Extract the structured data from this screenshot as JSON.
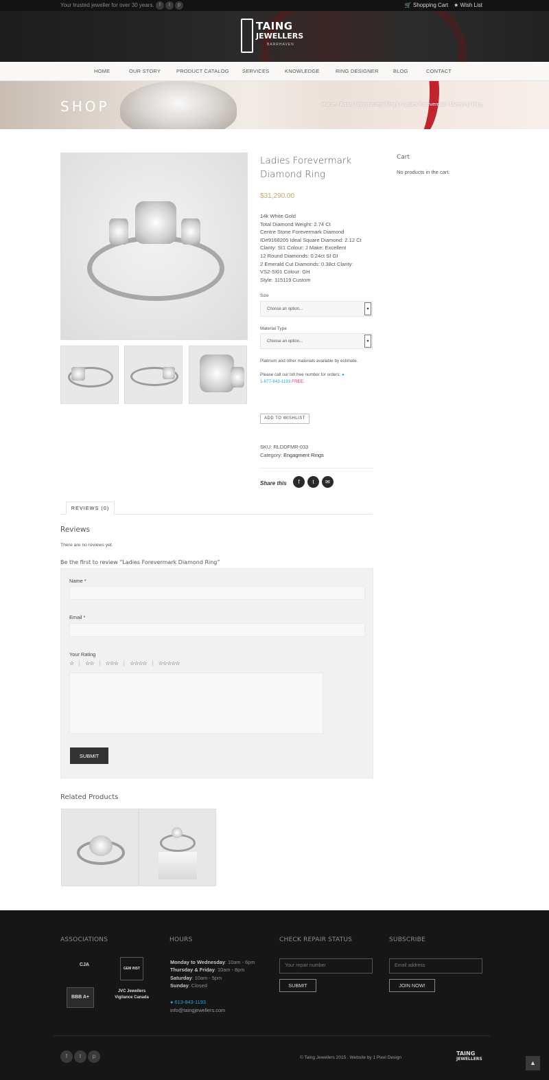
{
  "topbar": {
    "tagline": "Your trusted jeweller for over 30 years.",
    "social_icons": [
      "f",
      "t",
      "p"
    ],
    "cart": "Shopping Cart",
    "wishlist": "Wish List"
  },
  "logo": {
    "line1": "TAING",
    "line2": "JEWELLERS",
    "line3": "BARRHAVEN"
  },
  "nav": [
    "HOME",
    "OUR STORY",
    "PRODUCT CATALOG",
    "SERVICES",
    "KNOWLEDGE",
    "RING DESIGNER",
    "BLOG",
    "CONTACT"
  ],
  "banner": {
    "title": "SHOP",
    "breadcrumb": "Home / Bridal / Engagment Rings / Ladies Forevermark Diamond Ring"
  },
  "product": {
    "title": "Ladies Forevermark Diamond Ring",
    "price": "$31,290.00",
    "description": [
      "14k White Gold",
      "Total Diamond Weight: 2.74 Ct",
      "Centre Stone Forevermark Diamond",
      "ID#9168205 Ideal Square Diamond: 2.12 Ct",
      "Clarity: SI1 Colour: J Make: Excellent",
      "12 Round Diamonds: 0.24ct SI GI",
      "2 Emerald Cut Diamonds: 0.38ct Clarity:",
      "VS2-SI01 Colour: GH",
      "Style: 115119 Custom"
    ],
    "size_label": "Size",
    "size_placeholder": "Choose an option...",
    "material_label": "Material Type",
    "material_placeholder": "Choose an option...",
    "estimate_note": "Platinum and other materials available by estimate.",
    "call_note": "Please call our toll free number for orders:",
    "phone": "1-877-843-1193",
    "free": "FREE.",
    "wishlist_button": "ADD TO WISHLIST",
    "sku_label": "SKU:",
    "sku": "RLDDFMR-033",
    "category_label": "Category:",
    "category": "Engagment Rings",
    "share_label": "Share this"
  },
  "sidebar": {
    "cart_title": "Cart",
    "cart_empty": "No products in the cart."
  },
  "reviews": {
    "tab": "REVIEWS (0)",
    "heading": "Reviews",
    "none": "There are no reviews yet.",
    "first": "Be the first to review “Ladies Forevermark Diamond Ring”",
    "name_label": "Name *",
    "email_label": "Email *",
    "rating_label": "Your Rating",
    "stars": [
      "☆",
      "☆☆",
      "☆☆☆",
      "☆☆☆☆",
      "☆☆☆☆☆"
    ],
    "submit": "SUBMIT"
  },
  "related": {
    "heading": "Related Products"
  },
  "footer": {
    "associations_title": "ASSOCIATIONS",
    "assoc_logos": [
      "CJA",
      "GEM INST",
      "BBB A+",
      "JVC Jewellers Vigilance Canada"
    ],
    "hours_title": "HOURS",
    "hours": [
      {
        "day": "Monday to Wednesday",
        "time": ": 10am - 6pm"
      },
      {
        "day": "Thursday & Friday",
        "time": ": 10am - 8pm"
      },
      {
        "day": "Saturday",
        "time": ": 10am - 5pm"
      },
      {
        "day": "Sunday",
        "time": ": Closed"
      }
    ],
    "phone": "613-843-1193",
    "email": "info@taingjewellers.com",
    "repair_title": "CHECK REPAIR STATUS",
    "repair_placeholder": "Your repair number",
    "repair_button": "SUBMIT",
    "subscribe_title": "SUBSCRIBE",
    "subscribe_placeholder": "Email address",
    "subscribe_button": "JOIN NOW!",
    "copyright": "© Taing Jewellers 2015 . Website by 1 Pixel Design",
    "logo_line1": "TAING",
    "logo_line2": "JEWELLERS",
    "to_top": "▲"
  }
}
